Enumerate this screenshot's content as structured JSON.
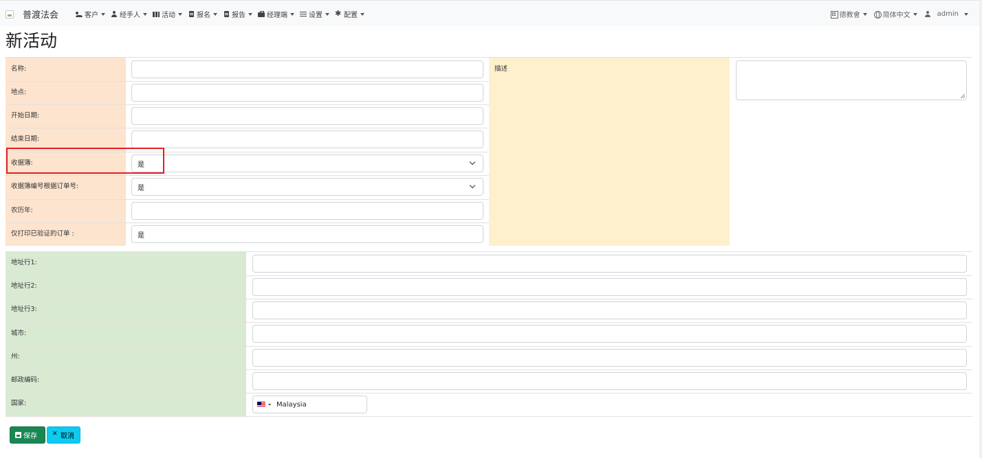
{
  "nav": {
    "brand": "普渡法会",
    "items": [
      {
        "label": "客户",
        "icon": "users-icon"
      },
      {
        "label": "经手人",
        "icon": "user-icon"
      },
      {
        "label": "活动",
        "icon": "map-icon"
      },
      {
        "label": "报名",
        "icon": "document-icon"
      },
      {
        "label": "报告",
        "icon": "document-icon"
      },
      {
        "label": "经理端",
        "icon": "briefcase-icon"
      },
      {
        "label": "设置",
        "icon": "sliders-icon"
      },
      {
        "label": "配置",
        "icon": "gear-icon"
      }
    ],
    "right": {
      "org": "德教會",
      "language": "简体中文",
      "user": "admin"
    }
  },
  "page": {
    "title": "新活动"
  },
  "form": {
    "name_label": "名称:",
    "name_value": "",
    "location_label": "地点:",
    "location_value": "",
    "start_date_label": "开始日期:",
    "start_date_value": "",
    "end_date_label": "结束日期:",
    "end_date_value": "",
    "receipt_book_label": "收据簿:",
    "receipt_book_value": "是",
    "receipt_numbering_label": "收据簿编号根据订单号:",
    "receipt_numbering_value": "是",
    "lunar_year_label": "农历年:",
    "lunar_year_value": "",
    "print_verified_label": "仅打印已验证的订单 :",
    "print_verified_value": "是",
    "description_label": "描述",
    "description_value": ""
  },
  "address": {
    "line1_label": "地址行1:",
    "line2_label": "地址行2:",
    "line3_label": "地址行3:",
    "city_label": "城市:",
    "state_label": "州:",
    "postcode_label": "邮政编码:",
    "country_label": "国家:",
    "country_value": "Malaysia"
  },
  "buttons": {
    "save": "保存",
    "cancel": "取消"
  }
}
